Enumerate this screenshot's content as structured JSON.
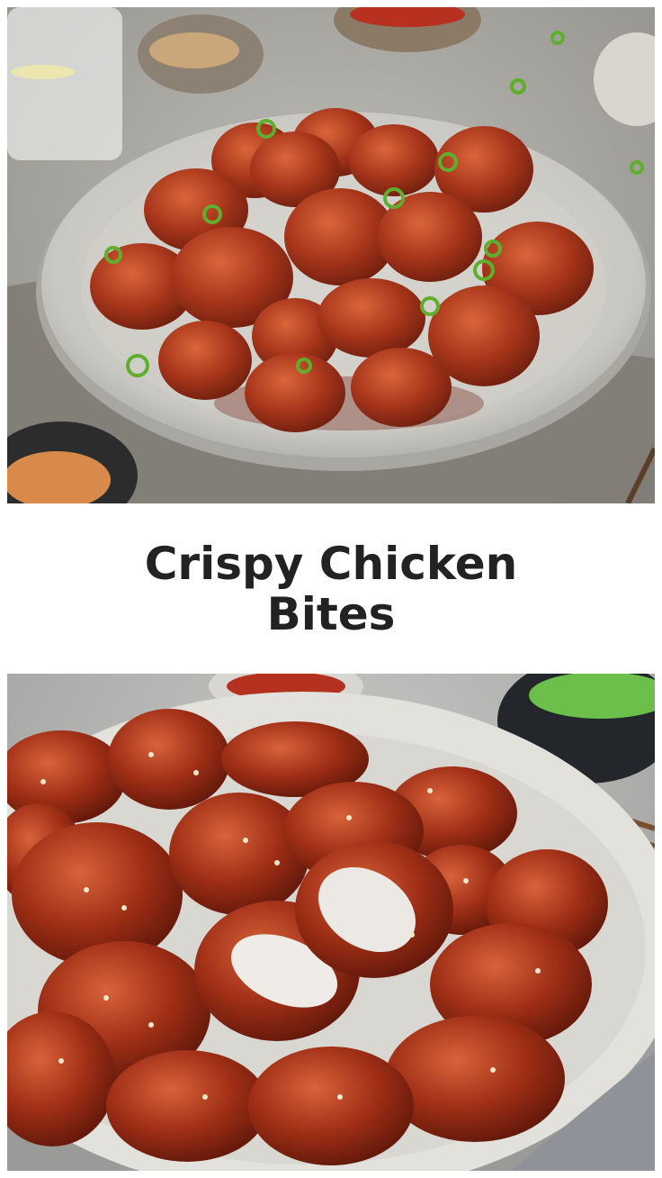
{
  "title": "Crispy Chicken Bites",
  "images": [
    {
      "name": "top-photo",
      "description_icon": "plate-of-glazed-chicken-bites-icon"
    },
    {
      "name": "bottom-photo",
      "description_icon": "closeup-chicken-bites-cut-open-icon"
    }
  ],
  "colors": {
    "background": "#ffffff",
    "title_text": "#222222",
    "glaze": "#a9391c",
    "plate": "#dedcd6"
  }
}
